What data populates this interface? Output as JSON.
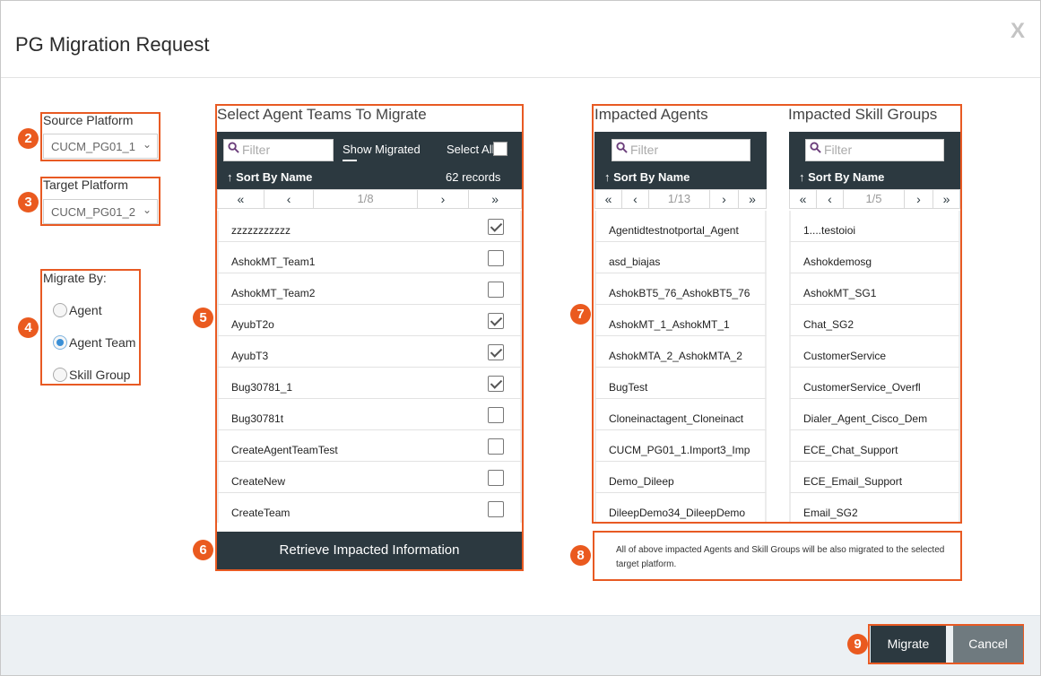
{
  "dialog": {
    "title": "PG Migration Request",
    "close_label": "X"
  },
  "badges": {
    "b2": "2",
    "b3": "3",
    "b4": "4",
    "b5": "5",
    "b6": "6",
    "b7": "7",
    "b8": "8",
    "b9": "9"
  },
  "source": {
    "label": "Source Platform",
    "value": "CUCM_PG01_1"
  },
  "target": {
    "label": "Target Platform",
    "value": "CUCM_PG01_2"
  },
  "migrate_by": {
    "label": "Migrate By:",
    "options": [
      {
        "label": "Agent",
        "selected": false
      },
      {
        "label": "Agent Team",
        "selected": true
      },
      {
        "label": "Skill Group",
        "selected": false
      }
    ]
  },
  "teams": {
    "title": "Select Agent Teams To Migrate",
    "filter_placeholder": "Filter",
    "show_migrated": "Show Migrated",
    "select_all": "Select All",
    "sort_label": "Sort By Name",
    "records": "62 records",
    "page": "1/8",
    "rows": [
      {
        "name": "zzzzzzzzzzz",
        "checked": true
      },
      {
        "name": "AshokMT_Team1",
        "checked": false
      },
      {
        "name": "AshokMT_Team2",
        "checked": false
      },
      {
        "name": "AyubT2o",
        "checked": true
      },
      {
        "name": "AyubT3",
        "checked": true
      },
      {
        "name": "Bug30781_1",
        "checked": true
      },
      {
        "name": "Bug30781t",
        "checked": false
      },
      {
        "name": "CreateAgentTeamTest",
        "checked": false
      },
      {
        "name": "CreateNew",
        "checked": false
      },
      {
        "name": "CreateTeam",
        "checked": false
      }
    ]
  },
  "retrieve_button": "Retrieve Impacted Information",
  "agents": {
    "title": "Impacted Agents",
    "filter_placeholder": "Filter",
    "sort_label": "Sort By Name",
    "page": "1/13",
    "rows": [
      "Agentidtestnotportal_Agent",
      "asd_biajas",
      "AshokBT5_76_AshokBT5_76",
      "AshokMT_1_AshokMT_1",
      "AshokMTA_2_AshokMTA_2",
      "BugTest",
      "Cloneinactagent_Cloneinact",
      "CUCM_PG01_1.Import3_Imp",
      "Demo_Dileep",
      "DileepDemo34_DileepDemo"
    ]
  },
  "skillgroups": {
    "title": "Impacted Skill Groups",
    "filter_placeholder": "Filter",
    "sort_label": "Sort By Name",
    "page": "1/5",
    "rows": [
      "1....testoioi",
      "Ashokdemosg",
      "AshokMT_SG1",
      "Chat_SG2",
      "CustomerService",
      "CustomerService_Overfl",
      "Dialer_Agent_Cisco_Dem",
      "ECE_Chat_Support",
      "ECE_Email_Support",
      "Email_SG2"
    ]
  },
  "note": "All of above impacted Agents and Skill Groups will be also migrated to the selected target platform.",
  "footer": {
    "migrate": "Migrate",
    "cancel": "Cancel"
  },
  "colors": {
    "accent_orange": "#e85a23",
    "dark_navy": "#2c3940",
    "radio_blue": "#3a8fd6"
  }
}
